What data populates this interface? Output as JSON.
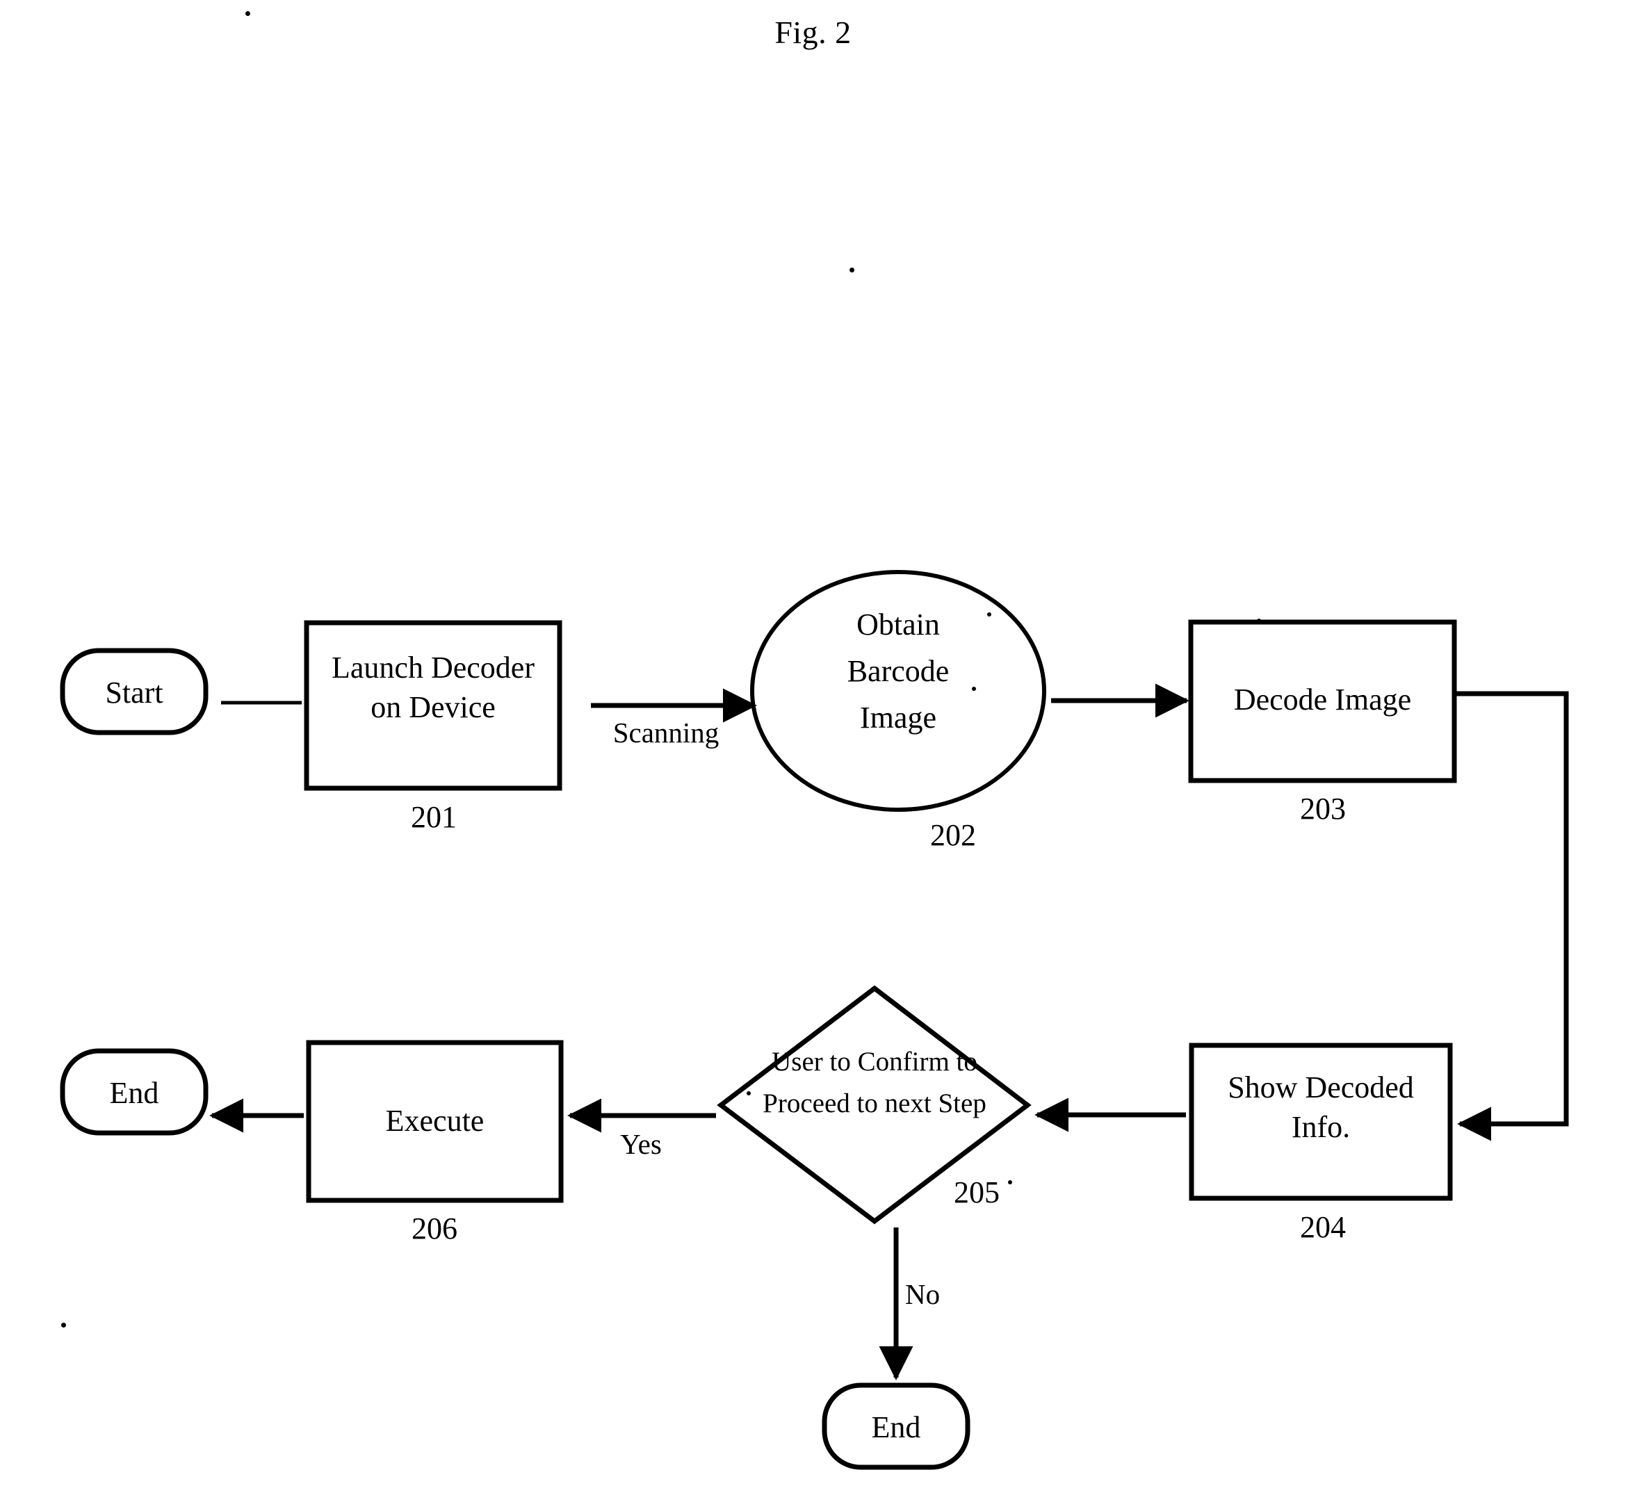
{
  "figure": {
    "title": "Fig. 2",
    "type": "flowchart"
  },
  "chart_data": {
    "type": "diagram",
    "title": "Fig. 2",
    "nodes": [
      {
        "id": "start",
        "label": "Start",
        "shape": "terminator",
        "ref": ""
      },
      {
        "id": "n201",
        "label": "Launch Decoder\non Device",
        "shape": "process",
        "ref": "201"
      },
      {
        "id": "n202",
        "label": "Obtain\nBarcode\nImage",
        "shape": "ellipse",
        "ref": "202"
      },
      {
        "id": "n203",
        "label": "Decode Image",
        "shape": "process",
        "ref": "203"
      },
      {
        "id": "n204",
        "label": "Show Decoded\nInfo.",
        "shape": "process",
        "ref": "204"
      },
      {
        "id": "n205",
        "label": "User to Confirm to\nProceed to next Step",
        "shape": "decision",
        "ref": "205"
      },
      {
        "id": "n206",
        "label": "Execute",
        "shape": "process",
        "ref": "206"
      },
      {
        "id": "end1",
        "label": "End",
        "shape": "terminator",
        "ref": ""
      },
      {
        "id": "end2",
        "label": "End",
        "shape": "terminator",
        "ref": ""
      }
    ],
    "edges": [
      {
        "from": "start",
        "to": "n201",
        "label": "",
        "arrow": false
      },
      {
        "from": "n201",
        "to": "n202",
        "label": "Scanning",
        "arrow": true
      },
      {
        "from": "n202",
        "to": "n203",
        "label": "",
        "arrow": true
      },
      {
        "from": "n203",
        "to": "n204",
        "label": "",
        "arrow": true
      },
      {
        "from": "n204",
        "to": "n205",
        "label": "",
        "arrow": true
      },
      {
        "from": "n205",
        "to": "n206",
        "label": "Yes",
        "arrow": true
      },
      {
        "from": "n206",
        "to": "end1",
        "label": "",
        "arrow": true
      },
      {
        "from": "n205",
        "to": "end2",
        "label": "No",
        "arrow": true
      }
    ],
    "edge_labels": [
      "Scanning",
      "Yes",
      "No"
    ],
    "reference_numerals": [
      "201",
      "202",
      "203",
      "204",
      "205",
      "206"
    ],
    "colors": {
      "stroke": "#000000",
      "background": "#ffffff",
      "text": "#000000"
    }
  }
}
